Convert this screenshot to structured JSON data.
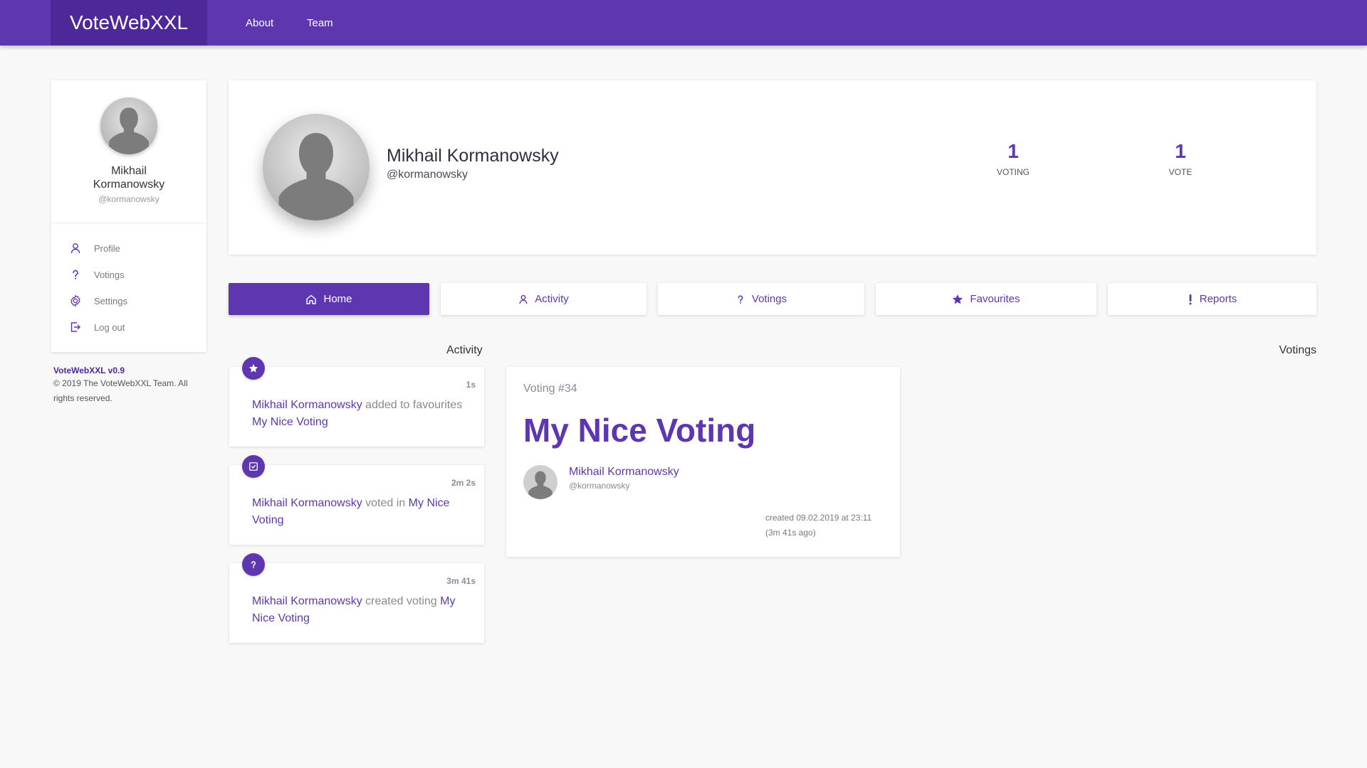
{
  "app": {
    "brand": "VoteWebXXL"
  },
  "navbar": {
    "links": [
      "About",
      "Team"
    ]
  },
  "sidebar": {
    "user_name": "Mikhail Kormanowsky",
    "user_handle": "@kormanowsky",
    "menu": [
      {
        "label": "Profile",
        "icon": "user-icon"
      },
      {
        "label": "Votings",
        "icon": "question-icon"
      },
      {
        "label": "Settings",
        "icon": "gear-icon"
      },
      {
        "label": "Log out",
        "icon": "logout-icon"
      }
    ],
    "footer": {
      "version": "VoteWebXXL v0.9",
      "copyright": "© 2019 The VoteWebXXL Team. All rights reserved."
    }
  },
  "profile": {
    "name": "Mikhail Kormanowsky",
    "handle": "@kormanowsky",
    "stats": [
      {
        "value": "1",
        "label": "VOTING"
      },
      {
        "value": "1",
        "label": "VOTE"
      }
    ]
  },
  "tabs": [
    {
      "label": "Home",
      "icon": "home-icon",
      "active": true
    },
    {
      "label": "Activity",
      "icon": "user-icon",
      "active": false
    },
    {
      "label": "Votings",
      "icon": "question-icon",
      "active": false
    },
    {
      "label": "Favourites",
      "icon": "star-icon",
      "active": false
    },
    {
      "label": "Reports",
      "icon": "exclamation-icon",
      "active": false
    }
  ],
  "sections": {
    "activity_title": "Activity",
    "votings_title": "Votings"
  },
  "activity": [
    {
      "icon": "star-icon",
      "time": "1s",
      "user": "Mikhail Kormanowsky",
      "action": "added to favourites",
      "target": "My Nice Voting"
    },
    {
      "icon": "check-square-icon",
      "time": "2m 2s",
      "user": "Mikhail Kormanowsky",
      "action": "voted in",
      "target": "My Nice Voting"
    },
    {
      "icon": "question-icon",
      "time": "3m 41s",
      "user": "Mikhail Kormanowsky",
      "action": "created voting",
      "target": "My Nice Voting"
    }
  ],
  "voting_card": {
    "number": "Voting #34",
    "title": "My Nice Voting",
    "author_name": "Mikhail Kormanowsky",
    "author_handle": "@kormanowsky",
    "created": "created 09.02.2019 at 23:11",
    "ago": "(3m 41s ago)"
  },
  "colors": {
    "accent": "#5e37b0",
    "accent_dark": "#4c2899",
    "background": "#f8f8f8"
  }
}
